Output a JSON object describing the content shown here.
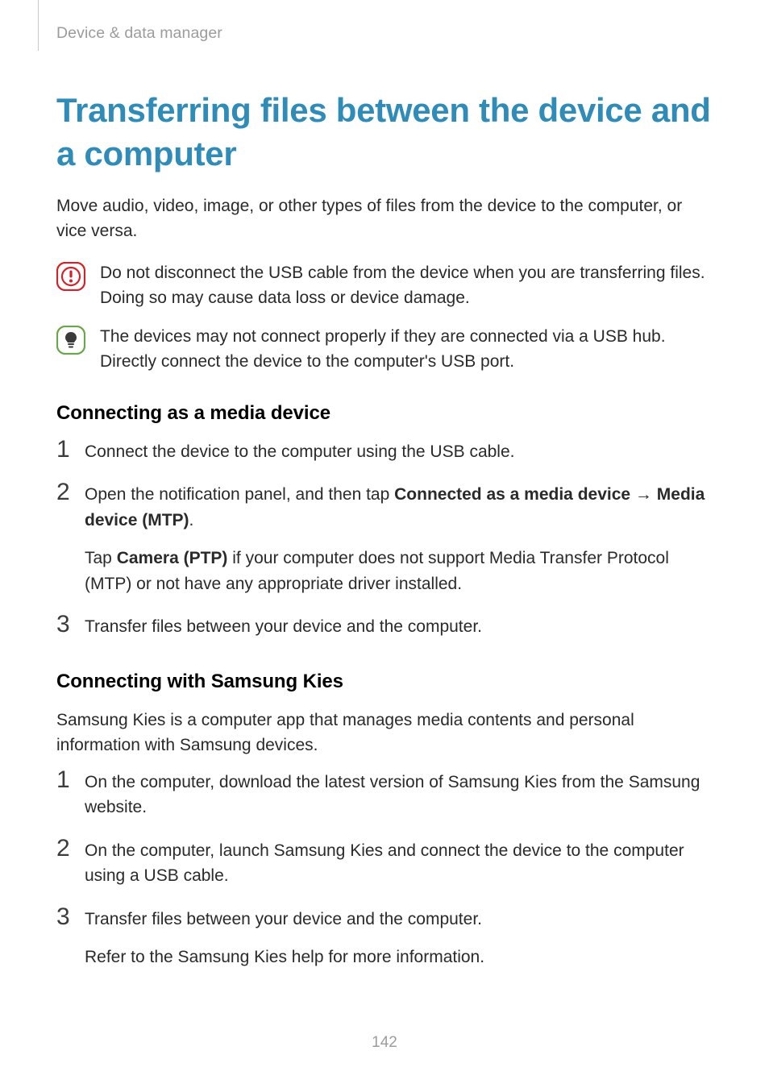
{
  "header": {
    "breadcrumb": "Device & data manager"
  },
  "title": "Transferring files between the device and a computer",
  "intro": "Move audio, video, image, or other types of files from the device to the computer, or vice versa.",
  "callouts": {
    "caution": "Do not disconnect the USB cable from the device when you are transferring files. Doing so may cause data loss or device damage.",
    "note": "The devices may not connect properly if they are connected via a USB hub. Directly connect the device to the computer's USB port."
  },
  "section1": {
    "heading": "Connecting as a media device",
    "step1": "Connect the device to the computer using the USB cable.",
    "step2_pre": "Open the notification panel, and then tap ",
    "step2_b1": "Connected as a media device",
    "step2_arrow": " → ",
    "step2_b2": "Media device (MTP)",
    "step2_post": ".",
    "step2_extra_pre": "Tap ",
    "step2_extra_b": "Camera (PTP)",
    "step2_extra_post": " if your computer does not support Media Transfer Protocol (MTP) or not have any appropriate driver installed.",
    "step3": "Transfer files between your device and the computer."
  },
  "section2": {
    "heading": "Connecting with Samsung Kies",
    "intro": "Samsung Kies is a computer app that manages media contents and personal information with Samsung devices.",
    "step1": "On the computer, download the latest version of Samsung Kies from the Samsung website.",
    "step2": "On the computer, launch Samsung Kies and connect the device to the computer using a USB cable.",
    "step3a": "Transfer files between your device and the computer.",
    "step3b": "Refer to the Samsung Kies help for more information."
  },
  "nums": {
    "one": "1",
    "two": "2",
    "three": "3"
  },
  "pagenum": "142"
}
